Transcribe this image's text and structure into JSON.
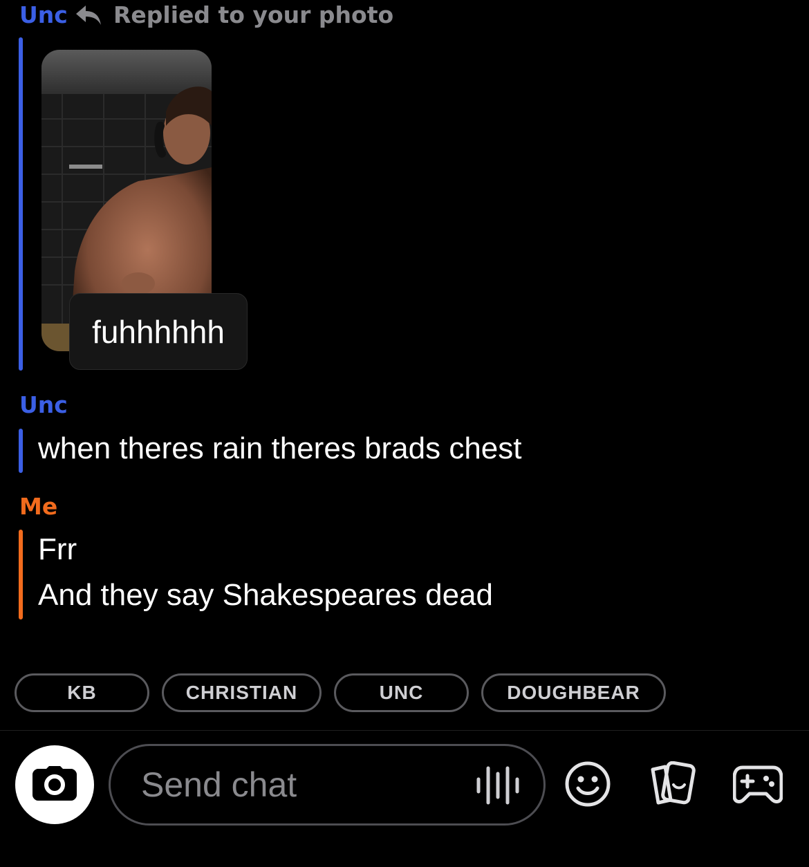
{
  "reply_header": {
    "sender": "Unc",
    "replied_label": "Replied to your photo"
  },
  "photo_reply": {
    "caption": "fuhhhhhh"
  },
  "messages": [
    {
      "sender": "Unc",
      "lines": [
        "when theres rain theres brads chest"
      ]
    },
    {
      "sender": "Me",
      "lines": [
        "Frr",
        "And they say Shakespeares dead"
      ]
    }
  ],
  "quick_chips": [
    "KB",
    "CHRISTIAN",
    "UNC",
    "DOUGHBEAR"
  ],
  "input": {
    "placeholder": "Send chat"
  },
  "colors": {
    "unc_accent": "#3b5fe5",
    "me_accent": "#f26b1d",
    "background": "#000000"
  },
  "icons": {
    "reply": "reply-arrow-icon",
    "camera": "camera-icon",
    "voice": "voice-waveform-icon",
    "emoji": "smiley-icon",
    "stickers": "cards-icon",
    "games": "gamepad-icon"
  }
}
